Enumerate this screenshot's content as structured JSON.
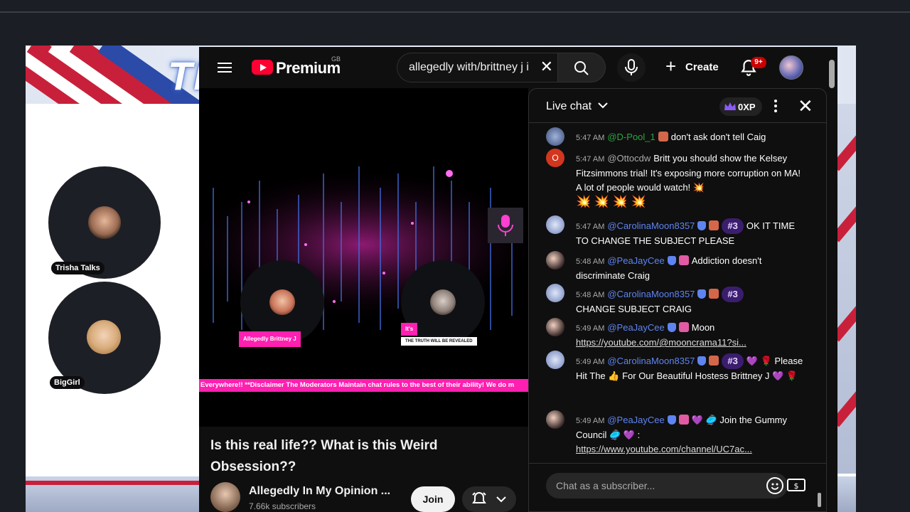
{
  "overlay": {
    "title_text": "TI",
    "cams": [
      {
        "label": "Trisha Talks"
      },
      {
        "label": "BigGirl"
      }
    ]
  },
  "masthead": {
    "logo_text": "Premium",
    "logo_region": "GB",
    "search_value": "allegedly with/brittney j i",
    "create_label": "Create",
    "notification_count": "9+"
  },
  "video": {
    "left_label": "Allegedly Brittney J",
    "right_label": "It's",
    "right_sublabel": "THE TRUTH WILL BE REVEALED",
    "ticker": "Everywhere!! **Disclaimer The Moderators Maintain chat rules to the best of their ability! We do m",
    "title": "Is this real life?? What is this Weird Obsession??",
    "channel_name": "Allegedly In My Opinion ...",
    "subscribers": "7.66k subscribers",
    "join_label": "Join"
  },
  "chat": {
    "title": "Live chat",
    "xp_label": "0XP",
    "input_placeholder": "Chat as a subscriber...",
    "messages": [
      {
        "time": "5:47 AM",
        "author": "@D-Pool_1",
        "text": "don't ask don't tell Caig"
      },
      {
        "time": "5:47 AM",
        "author": "@Ottocdw",
        "text": "Britt you should show the Kelsey Fitzsimmons trial! It's exposing more corruption on MA! A lot of people would watch! 💥",
        "emojis": "💥 💥 💥 💥"
      },
      {
        "time": "5:47 AM",
        "author": "@CarolinaMoon8357",
        "rank": "#3",
        "text": "OK IT TIME TO CHANGE THE SUBJECT PLEASE"
      },
      {
        "time": "5:48 AM",
        "author": "@PeaJayCee",
        "text": "Addiction doesn't discriminate Craig"
      },
      {
        "time": "5:48 AM",
        "author": "@CarolinaMoon8357",
        "rank": "#3",
        "text": "CHANGE SUBJECT CRAIG"
      },
      {
        "time": "5:49 AM",
        "author": "@PeaJayCee",
        "text": "Moon",
        "link": "https://youtube.com/@mooncrama11?si..."
      },
      {
        "time": "5:49 AM",
        "author": "@CarolinaMoon8357",
        "rank": "#3",
        "text": "💜 🌹 Please Hit The 👍 For Our Beautiful Hostess Brittney J 💜 🌹"
      },
      {
        "time": "5:49 AM",
        "author": "@PeaJayCee",
        "text": "💜 🥏 Join the Gummy Council 🥏 💜 :",
        "link": "https://www.youtube.com/channel/UC7ac..."
      }
    ]
  },
  "colors": {
    "youtube_red": "#ff0033",
    "moderator_blue": "#5e84f1",
    "ticker_pink": "#ff1fb0",
    "rank_purple": "#3b1d6e"
  },
  "icons": [
    "menu-icon",
    "youtube-logo-icon",
    "search-icon",
    "clear-icon",
    "mic-icon",
    "plus-icon",
    "bell-icon",
    "chevron-down-icon",
    "crown-icon",
    "more-vert-icon",
    "close-icon",
    "emoji-icon",
    "money-icon"
  ]
}
